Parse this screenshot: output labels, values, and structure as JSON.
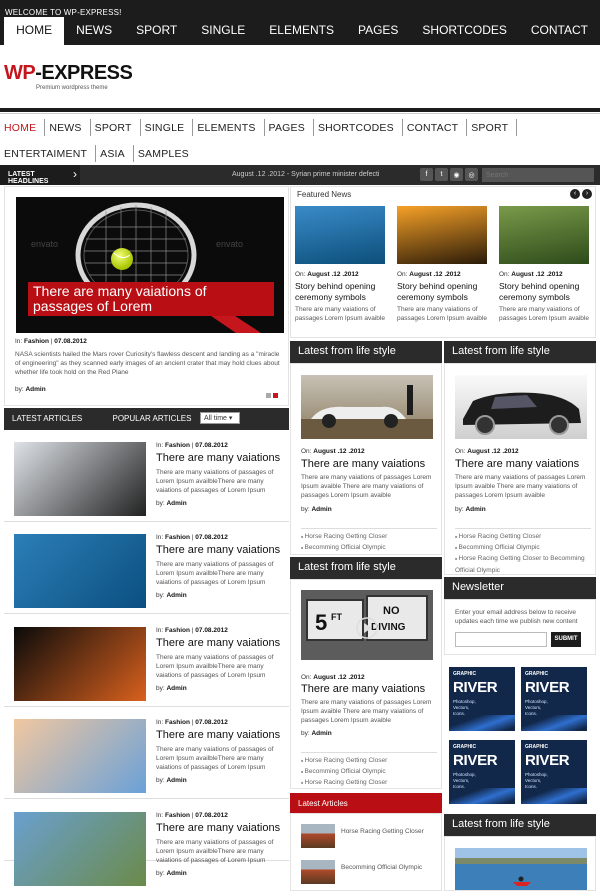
{
  "topbar": {
    "welcome": "WELCOME TO WP-EXPRESS!",
    "nav": [
      "HOME",
      "NEWS",
      "SPORT",
      "SINGLE",
      "ELEMENTS",
      "PAGES",
      "SHORTCODES",
      "CONTACT"
    ]
  },
  "logo": {
    "brand_a": "WP",
    "brand_b": "-EXPRESS",
    "tagline": "Premium wordpress theme"
  },
  "menu": [
    "HOME",
    "NEWS",
    "SPORT",
    "SINGLE",
    "ELEMENTS",
    "PAGES",
    "SHORTCODES",
    "CONTACT",
    "SPORT",
    "ENTERTAIMENT",
    "ASIA",
    "SAMPLES"
  ],
  "headlines": {
    "label": "LATEST HEADLINES",
    "ticker": "August .12 .2012 - Syrian prime minister defecti",
    "search_placeholder": "Search",
    "social": [
      "f",
      "t",
      "rss",
      "g"
    ]
  },
  "featured": {
    "caption": "There are many vaiations of passages of Lorem",
    "meta_in": "In:",
    "meta_cat": "Fashion",
    "meta_date": "07.08.2012",
    "excerpt": "NASA scientists hailed the Mars rover Curiosity's flawless descent and landing as a \"miracle of engineering\" as they scanned early images of an ancient crater that may hold clues about whether life took hold on the Red Plane",
    "by": "by:",
    "author": "Admin"
  },
  "tabs": {
    "latest": "LATEST ARTICLES",
    "popular": "POPULAR ARTICLES",
    "filter": "All time"
  },
  "articles": [
    {
      "cat": "Fashion",
      "date": "07.08.2012",
      "title": "There are many vaiations",
      "excerpt": "There are many vaiations of passages of Lorem Ipsum availbleThere are many vaiations of passages of Lorem Ipsum",
      "author": "Admin"
    },
    {
      "cat": "Fashion",
      "date": "07.08.2012",
      "title": "There are many vaiations",
      "excerpt": "There are many vaiations of passages of Lorem Ipsum availbleThere are many vaiations of passages of Lorem Ipsum",
      "author": "Admin"
    },
    {
      "cat": "Fashion",
      "date": "07.08.2012",
      "title": "There are many vaiations",
      "excerpt": "There are many vaiations of passages of Lorem Ipsum availbleThere are many vaiations of passages of Lorem Ipsum",
      "author": "Admin"
    },
    {
      "cat": "Fashion",
      "date": "07.08.2012",
      "title": "There are many vaiations",
      "excerpt": "There are many vaiations of passages of Lorem Ipsum availbleThere are many vaiations of passages of Lorem Ipsum",
      "author": "Admin"
    },
    {
      "cat": "Fashion",
      "date": "07.08.2012",
      "title": "There are many vaiations",
      "excerpt": "There are many vaiations of passages of Lorem Ipsum availbleThere are many vaiations of passages of Lorem Ipsum",
      "author": "Admin"
    }
  ],
  "featured_news": {
    "title": "Featured News",
    "items": [
      {
        "date_prefix": "On:",
        "date": "August .12 .2012",
        "title": "Story behind opening ceremony symbols",
        "excerpt": "There are many vaiations of passages Lorem Ipsum avaible"
      },
      {
        "date_prefix": "On:",
        "date": "August .12 .2012",
        "title": "Story behind opening ceremony symbols",
        "excerpt": "There are many vaiations of passages Lorem Ipsum avaible"
      },
      {
        "date_prefix": "On:",
        "date": "August .12 .2012",
        "title": "Story behind opening ceremony symbols",
        "excerpt": "There are many vaiations of passages Lorem Ipsum avaible"
      }
    ]
  },
  "life_style": {
    "title": "Latest from life style",
    "date_prefix": "On:",
    "date": "August .12 .2012",
    "post_title": "There are many vaiations",
    "excerpt": "There are many vaiations of passages Lorem Ipsum avaible There are many vaiations of passages Lorem Ipsum avaible",
    "by": "by:",
    "author": "Admin",
    "links": [
      "Horse Racing Getting Closer",
      "Becomming Official Olympic"
    ],
    "links_right": [
      "Horse Racing Getting Closer",
      "Becomming Official Olympic",
      "Horse Racing Getting Closer to Becomming Official Olympic"
    ],
    "links3": [
      "Horse Racing Getting Closer",
      "Becomming Official Olympic",
      "Horse Racing Getting Closer"
    ]
  },
  "latest_articles_box": {
    "title": "Latest Articles",
    "items": [
      "Horse Racing Getting Closer",
      "Becomming Official Olympic"
    ]
  },
  "newsletter": {
    "title": "Newsletter",
    "text": "Enter your email address below to receive updates each time we publish new content",
    "submit": "SUBMIT"
  },
  "ads": {
    "brand_small": "GRAPHIC",
    "brand": "RIVER",
    "sub": [
      "Photoshop,",
      "Vectors,",
      "Icons,",
      "and More..."
    ]
  }
}
